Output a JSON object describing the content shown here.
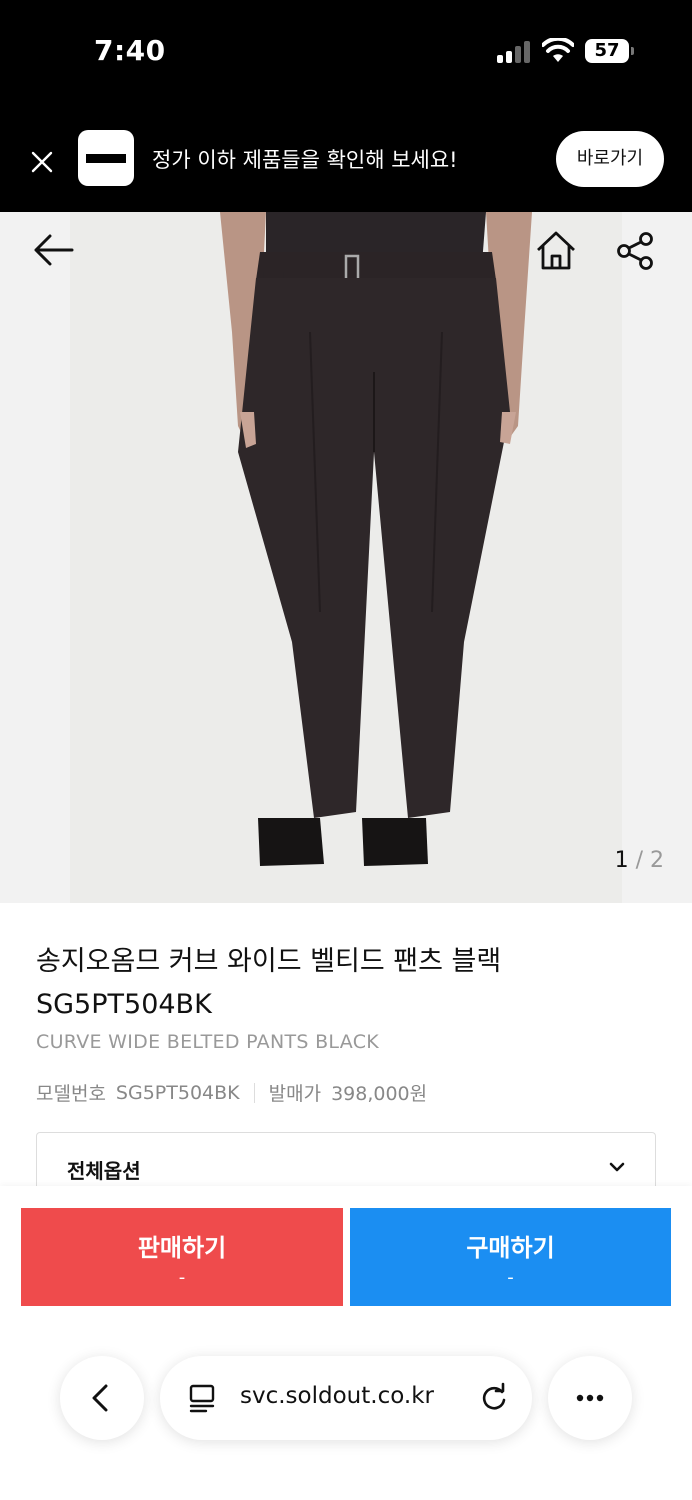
{
  "status": {
    "time": "7:40",
    "battery": "57"
  },
  "promo": {
    "text": "정가 이하 제품들을 확인해 보세요!",
    "button": "바로가기"
  },
  "gallery": {
    "current": "1",
    "separator": " / ",
    "total": "2"
  },
  "product": {
    "name_line1": "송지오옴므 커브 와이드 벨티드 팬츠 블랙",
    "name_line2": "SG5PT504BK",
    "name_en": "CURVE WIDE BELTED PANTS BLACK",
    "model_label": "모델번호",
    "model_value": "SG5PT504BK",
    "release_label": "발매가",
    "release_value": "398,000원"
  },
  "options": {
    "label": "전체옵션"
  },
  "actions": {
    "sell_label": "판매하기",
    "sell_price": "-",
    "buy_label": "구매하기",
    "buy_price": "-"
  },
  "browser": {
    "url": "svc.soldout.co.kr"
  },
  "colors": {
    "sell": "#ef4b4c",
    "buy": "#1b8ef2"
  }
}
